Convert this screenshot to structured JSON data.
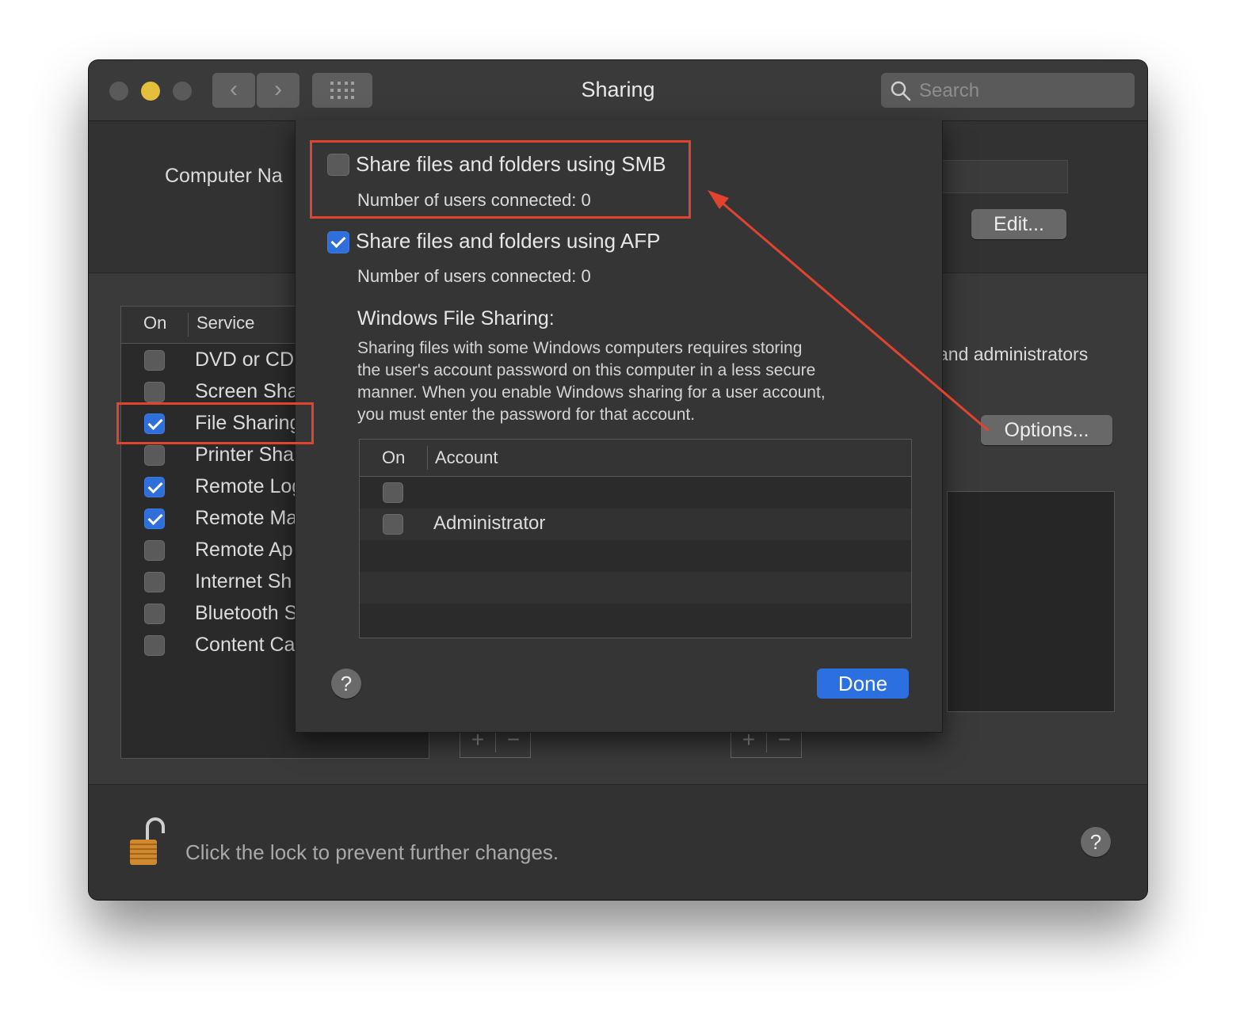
{
  "window": {
    "title": "Sharing",
    "search_placeholder": "Search",
    "back_glyph": "‹",
    "forward_glyph": "›",
    "grid_icon": "grid-icon"
  },
  "main": {
    "computer_name_label": "Computer Na",
    "edit_button": "Edit...",
    "options_button": "Options...",
    "partial_admin_text": "and administrators",
    "lock_text": "Click the lock to prevent further changes.",
    "help_glyph": "?"
  },
  "services": {
    "header_on": "On",
    "header_service": "Service",
    "items": [
      {
        "label": "DVD or CD",
        "checked": false
      },
      {
        "label": "Screen Sha",
        "checked": false
      },
      {
        "label": "File Sharing",
        "checked": true
      },
      {
        "label": "Printer Sha",
        "checked": false
      },
      {
        "label": "Remote Log",
        "checked": true
      },
      {
        "label": "Remote Ma",
        "checked": true
      },
      {
        "label": "Remote Ap",
        "checked": false
      },
      {
        "label": "Internet Sh",
        "checked": false
      },
      {
        "label": "Bluetooth S",
        "checked": false
      },
      {
        "label": "Content Ca",
        "checked": false
      }
    ]
  },
  "sheet": {
    "smb_label": "Share files and folders using SMB",
    "smb_checked": false,
    "smb_users": "Number of users connected: 0",
    "afp_label": "Share files and folders using AFP",
    "afp_checked": true,
    "afp_users": "Number of users connected: 0",
    "windows_heading": "Windows File Sharing:",
    "windows_desc": [
      "Sharing files with some Windows computers requires storing",
      "the user's account password on this computer in a less secure",
      "manner. When you enable Windows sharing for a user account,",
      "you must enter the password for that account."
    ],
    "table_header_on": "On",
    "table_header_account": "Account",
    "accounts": [
      {
        "name": "",
        "checked": false
      },
      {
        "name": "Administrator",
        "checked": false
      }
    ],
    "help_glyph": "?",
    "done_button": "Done"
  },
  "colors": {
    "highlight": "#e0442f",
    "accent": "#2c6fe0",
    "minimize_light": "#e4bf3b"
  }
}
